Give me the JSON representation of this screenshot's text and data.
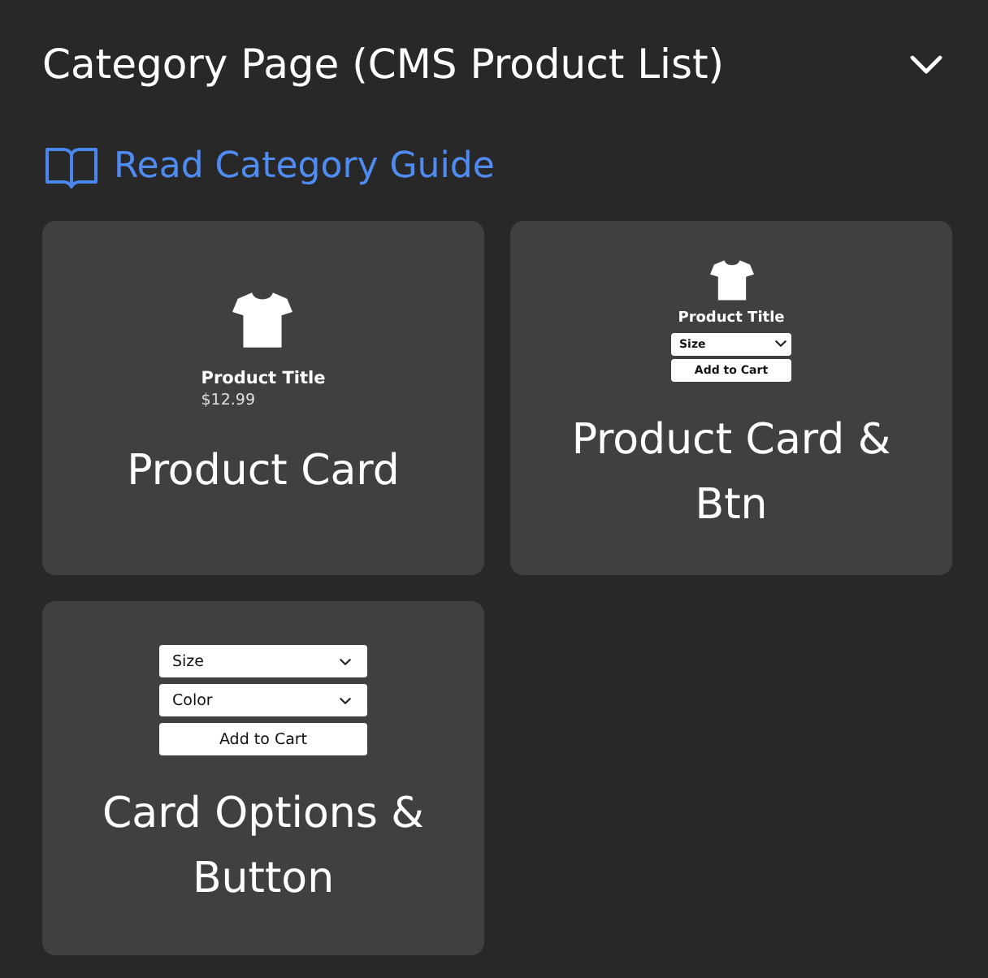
{
  "section": {
    "title": "Category Page (CMS Product List)",
    "expanded": true
  },
  "guide_link": {
    "label": "Read Category Guide"
  },
  "cards": [
    {
      "kind": "card",
      "title": "Product Card",
      "preview": {
        "product_title": "Product Title",
        "price": "$12.99"
      }
    },
    {
      "kind": "compact",
      "title": "Product Card & Btn",
      "preview": {
        "product_title": "Product Title",
        "options": [
          "Size"
        ],
        "button": "Add to Cart"
      }
    },
    {
      "kind": "options",
      "title": "Card Options & Button",
      "preview": {
        "options": [
          "Size",
          "Color"
        ],
        "button": "Add to Cart"
      }
    }
  ]
}
